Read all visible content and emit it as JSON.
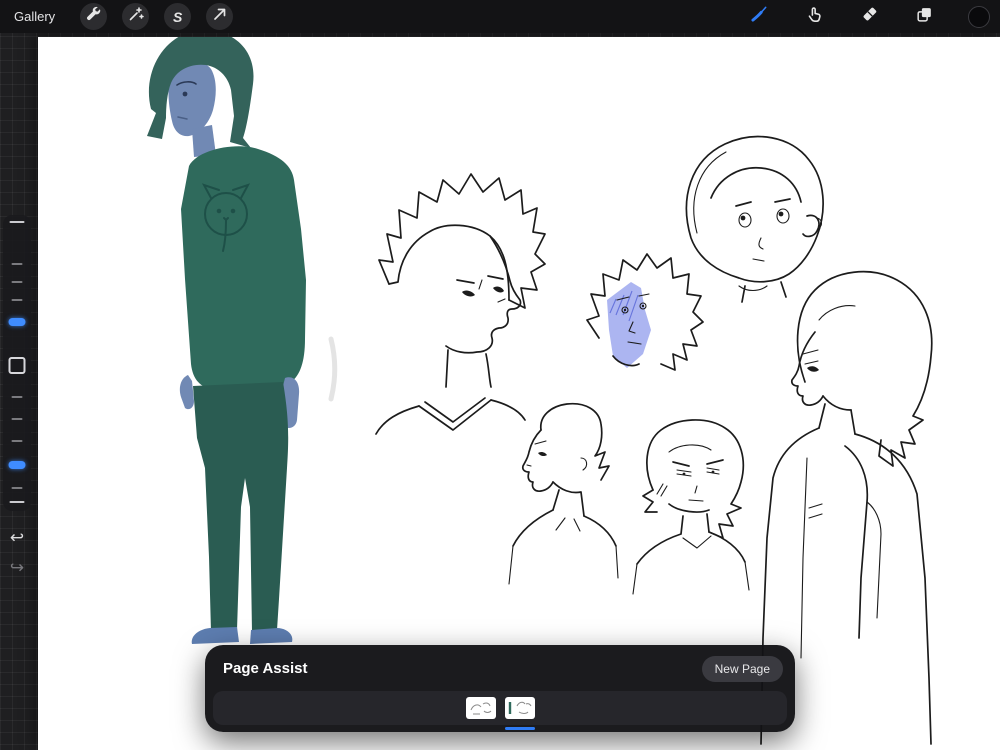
{
  "topbar": {
    "gallery_label": "Gallery",
    "selection_glyph": "S",
    "accent_color": "#2f7cf6",
    "left_tools": [
      {
        "id": "actions",
        "icon": "wrench-icon"
      },
      {
        "id": "adjustments",
        "icon": "magic-wand-icon"
      },
      {
        "id": "selection",
        "icon": "selection-s-icon"
      },
      {
        "id": "transform",
        "icon": "transform-arrow-icon"
      }
    ],
    "right_tools": [
      {
        "id": "paint",
        "icon": "brush-icon",
        "active": true
      },
      {
        "id": "smudge",
        "icon": "smudge-finger-icon",
        "active": false
      },
      {
        "id": "erase",
        "icon": "eraser-icon",
        "active": false
      },
      {
        "id": "layers",
        "icon": "layers-icon",
        "active": false
      },
      {
        "id": "color",
        "icon": "color-swatch-icon",
        "swatch_color": "#0a0a0c",
        "active": false
      }
    ]
  },
  "sidebar": {
    "handle_color": "#3f8cff",
    "undo_glyph": "↩",
    "redo_glyph": "↪"
  },
  "page_assist": {
    "title": "Page Assist",
    "new_page_label": "New Page",
    "selection_color": "#2f7cf6",
    "pages": [
      {
        "index": 1,
        "selected": false
      },
      {
        "index": 2,
        "selected": true
      }
    ]
  },
  "canvas": {
    "background": "#ffffff",
    "artwork_palette": {
      "hair": "#34635b",
      "skin": "#7189b4",
      "sweater": "#2f6a5c",
      "pants": "#2a5c52",
      "shoes": "#5d7db0",
      "ink": "#1c1c1c",
      "wash": "#97a3ee"
    }
  }
}
